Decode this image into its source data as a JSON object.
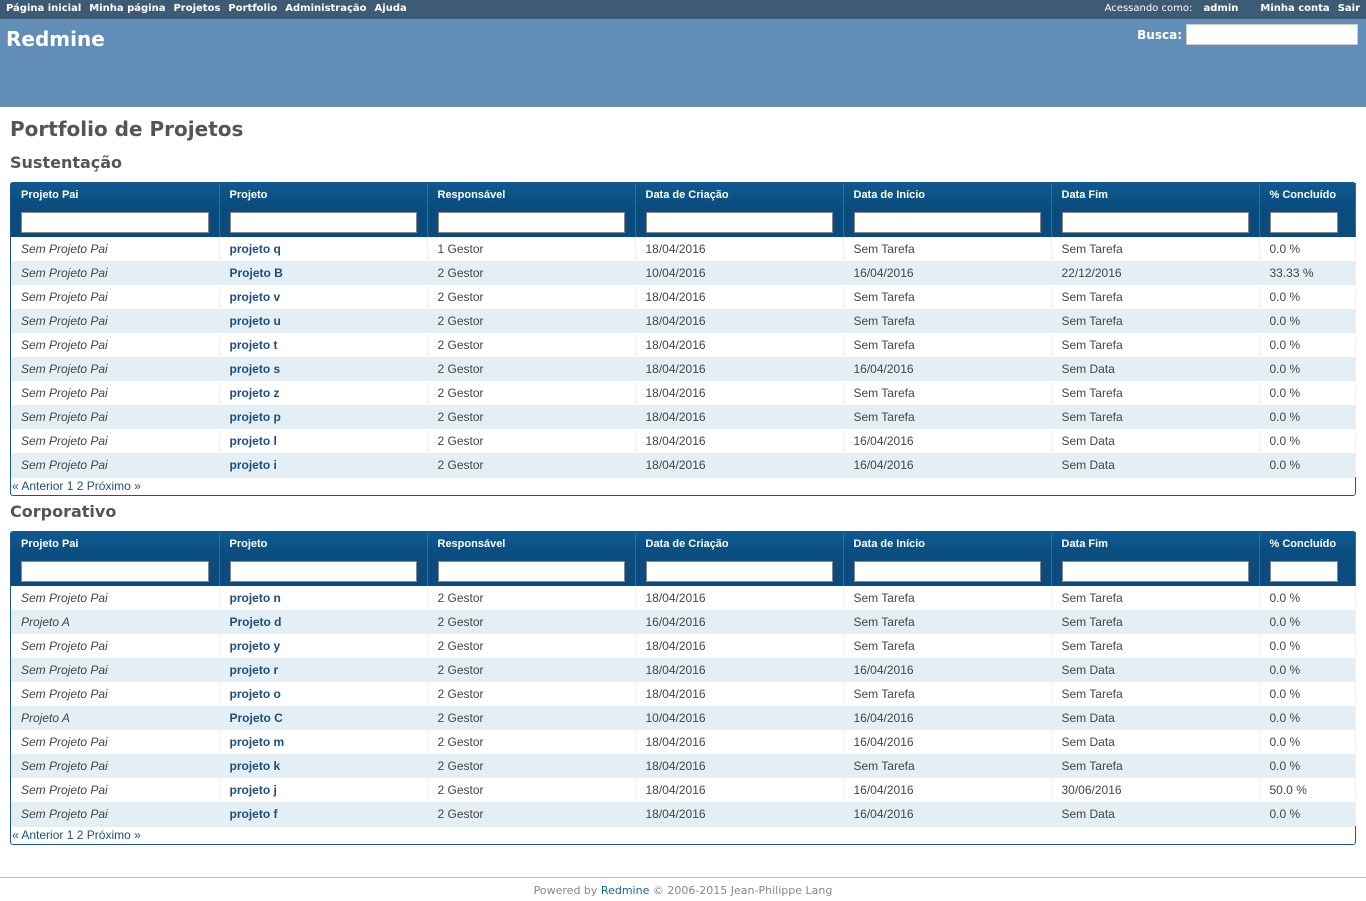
{
  "top_menu": {
    "items": [
      "Página inicial",
      "Minha página",
      "Projetos",
      "Portfolio",
      "Administração",
      "Ajuda"
    ],
    "logged_as_label": "Acessando como:",
    "logged_as_user": "admin",
    "account": "Minha conta",
    "logout": "Sair"
  },
  "header": {
    "title": "Redmine",
    "search_label": "Busca:"
  },
  "page_title": "Portfolio de Projetos",
  "columns": [
    "Projeto Pai",
    "Projeto",
    "Responsável",
    "Data de Criação",
    "Data de Início",
    "Data Fim",
    "% Concluído"
  ],
  "groups": [
    {
      "title": "Sustentação",
      "rows": [
        [
          "Sem Projeto Pai",
          "projeto q",
          "1 Gestor",
          "18/04/2016",
          "Sem Tarefa",
          "Sem Tarefa",
          "0.0 %"
        ],
        [
          "Sem Projeto Pai",
          "Projeto B",
          "2 Gestor",
          "10/04/2016",
          "16/04/2016",
          "22/12/2016",
          "33.33 %"
        ],
        [
          "Sem Projeto Pai",
          "projeto v",
          "2 Gestor",
          "18/04/2016",
          "Sem Tarefa",
          "Sem Tarefa",
          "0.0 %"
        ],
        [
          "Sem Projeto Pai",
          "projeto u",
          "2 Gestor",
          "18/04/2016",
          "Sem Tarefa",
          "Sem Tarefa",
          "0.0 %"
        ],
        [
          "Sem Projeto Pai",
          "projeto t",
          "2 Gestor",
          "18/04/2016",
          "Sem Tarefa",
          "Sem Tarefa",
          "0.0 %"
        ],
        [
          "Sem Projeto Pai",
          "projeto s",
          "2 Gestor",
          "18/04/2016",
          "16/04/2016",
          "Sem Data",
          "0.0 %"
        ],
        [
          "Sem Projeto Pai",
          "projeto z",
          "2 Gestor",
          "18/04/2016",
          "Sem Tarefa",
          "Sem Tarefa",
          "0.0 %"
        ],
        [
          "Sem Projeto Pai",
          "projeto p",
          "2 Gestor",
          "18/04/2016",
          "Sem Tarefa",
          "Sem Tarefa",
          "0.0 %"
        ],
        [
          "Sem Projeto Pai",
          "projeto l",
          "2 Gestor",
          "18/04/2016",
          "16/04/2016",
          "Sem Data",
          "0.0 %"
        ],
        [
          "Sem Projeto Pai",
          "projeto i",
          "2 Gestor",
          "18/04/2016",
          "16/04/2016",
          "Sem Data",
          "0.0 %"
        ]
      ],
      "pager": {
        "prev": "« Anterior",
        "pages": [
          "1",
          "2"
        ],
        "next": "Próximo »"
      }
    },
    {
      "title": "Corporativo",
      "rows": [
        [
          "Sem Projeto Pai",
          "projeto n",
          "2 Gestor",
          "18/04/2016",
          "Sem Tarefa",
          "Sem Tarefa",
          "0.0 %"
        ],
        [
          "Projeto A",
          "Projeto d",
          "2 Gestor",
          "16/04/2016",
          "Sem Tarefa",
          "Sem Tarefa",
          "0.0 %"
        ],
        [
          "Sem Projeto Pai",
          "projeto y",
          "2 Gestor",
          "18/04/2016",
          "Sem Tarefa",
          "Sem Tarefa",
          "0.0 %"
        ],
        [
          "Sem Projeto Pai",
          "projeto r",
          "2 Gestor",
          "18/04/2016",
          "16/04/2016",
          "Sem Data",
          "0.0 %"
        ],
        [
          "Sem Projeto Pai",
          "projeto o",
          "2 Gestor",
          "18/04/2016",
          "Sem Tarefa",
          "Sem Tarefa",
          "0.0 %"
        ],
        [
          "Projeto A",
          "Projeto C",
          "2 Gestor",
          "10/04/2016",
          "16/04/2016",
          "Sem Data",
          "0.0 %"
        ],
        [
          "Sem Projeto Pai",
          "projeto m",
          "2 Gestor",
          "18/04/2016",
          "16/04/2016",
          "Sem Data",
          "0.0 %"
        ],
        [
          "Sem Projeto Pai",
          "projeto k",
          "2 Gestor",
          "18/04/2016",
          "Sem Tarefa",
          "Sem Tarefa",
          "0.0 %"
        ],
        [
          "Sem Projeto Pai",
          "projeto j",
          "2 Gestor",
          "18/04/2016",
          "16/04/2016",
          "30/06/2016",
          "50.0 %"
        ],
        [
          "Sem Projeto Pai",
          "projeto f",
          "2 Gestor",
          "18/04/2016",
          "16/04/2016",
          "Sem Data",
          "0.0 %"
        ]
      ],
      "pager": {
        "prev": "« Anterior",
        "pages": [
          "1",
          "2"
        ],
        "next": "Próximo »"
      }
    }
  ],
  "footer": {
    "powered_by": "Powered by",
    "link": "Redmine",
    "copyright": "© 2006-2015 Jean-Philippe Lang"
  }
}
